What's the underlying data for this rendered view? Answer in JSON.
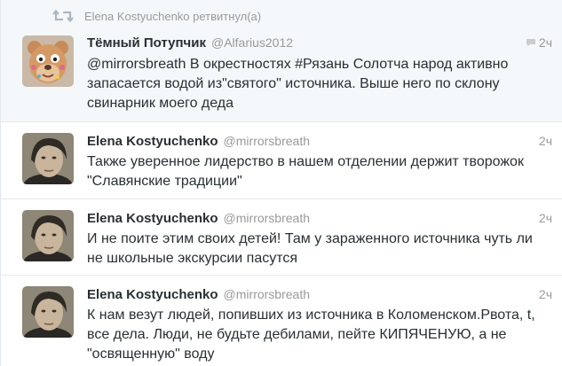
{
  "retweet": {
    "label": "Elena Kostyuchenko ретвитнул(а)",
    "icon": "retweet-icon"
  },
  "tweets": [
    {
      "fullname": "Тёмный Потупчик",
      "username": "@Alfarius2012",
      "time": "2ч",
      "text": "@mirrorsbreath В окрестностях #Рязань Солотча народ активно\nзапасается водой из\"святого\" источника. Выше него по склону\nсвинарник моего деда",
      "avatar": "bear-avatar"
    },
    {
      "fullname": "Elena Kostyuchenko",
      "username": "@mirrorsbreath",
      "time": "2ч",
      "text": "Также уверенное лидерство в нашем отделении держит творожок\n\"Славянские традиции\"",
      "avatar": "portrait-avatar"
    },
    {
      "fullname": "Elena Kostyuchenko",
      "username": "@mirrorsbreath",
      "time": "2ч",
      "text": "И не поите этим своих детей! Там у зараженного источника чуть ли\nне школьные экскурсии пасутся",
      "avatar": "portrait-avatar"
    },
    {
      "fullname": "Elena Kostyuchenko",
      "username": "@mirrorsbreath",
      "time": "2ч",
      "text": "К нам везут людей, попивших из источника в Коломенском.Рвота, t,\nвсе дела. Люди, не будьте дебилами, пейте КИПЯЧЕНУЮ, а не\n\"освященную\" воду",
      "avatar": "portrait-avatar"
    }
  ]
}
